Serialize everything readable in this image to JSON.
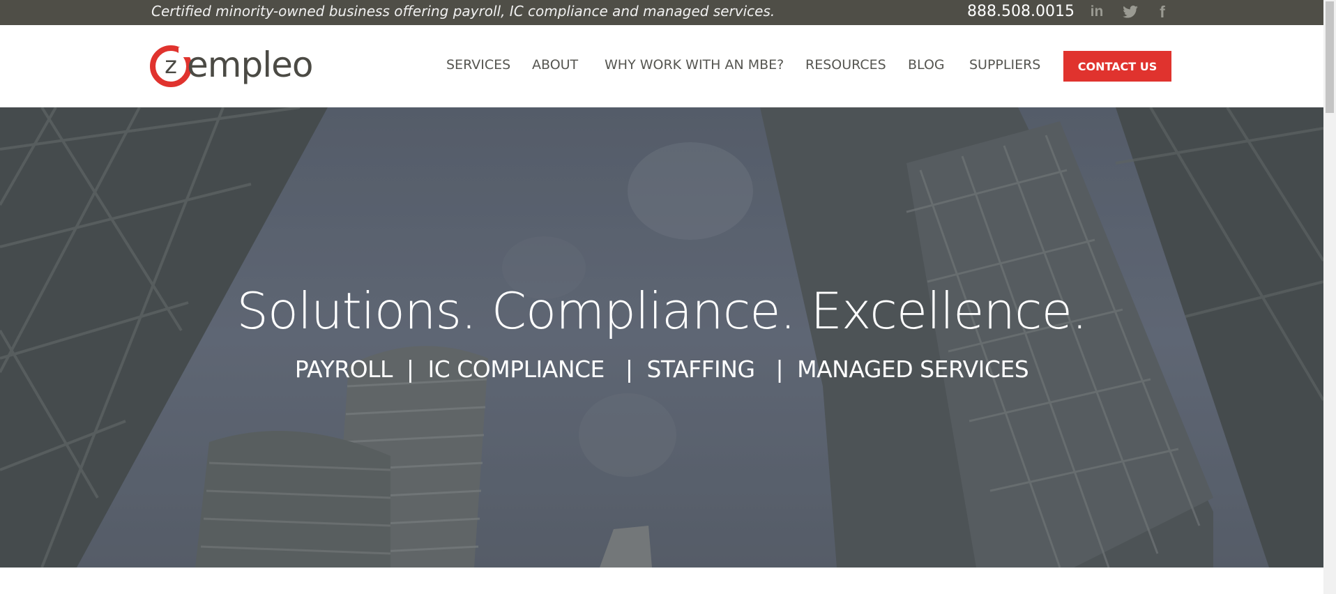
{
  "topbar": {
    "tagline": "Certified minority-owned business offering payroll, IC compliance and managed services.",
    "phone": "888.508.0015",
    "social": [
      {
        "name": "linkedin-icon",
        "glyph": "in"
      },
      {
        "name": "twitter-icon",
        "glyph": "twitter"
      },
      {
        "name": "facebook-icon",
        "glyph": "f"
      }
    ]
  },
  "header": {
    "logo_text": "empleo",
    "logo_letter": "z",
    "nav": [
      "SERVICES",
      "ABOUT",
      "WHY WORK WITH AN MBE?",
      "RESOURCES",
      "BLOG",
      "SUPPLIERS"
    ],
    "contact_label": "CONTACT US"
  },
  "hero": {
    "title": "Solutions. Compliance. Excellence.",
    "subtitle": "PAYROLL  |  IC COMPLIANCE   |  STAFFING   |  MANAGED SERVICES"
  },
  "colors": {
    "topbar_bg": "#4f4e47",
    "accent": "#e0332e",
    "nav_text": "#555550",
    "hero_overlay": "#5a6270"
  }
}
